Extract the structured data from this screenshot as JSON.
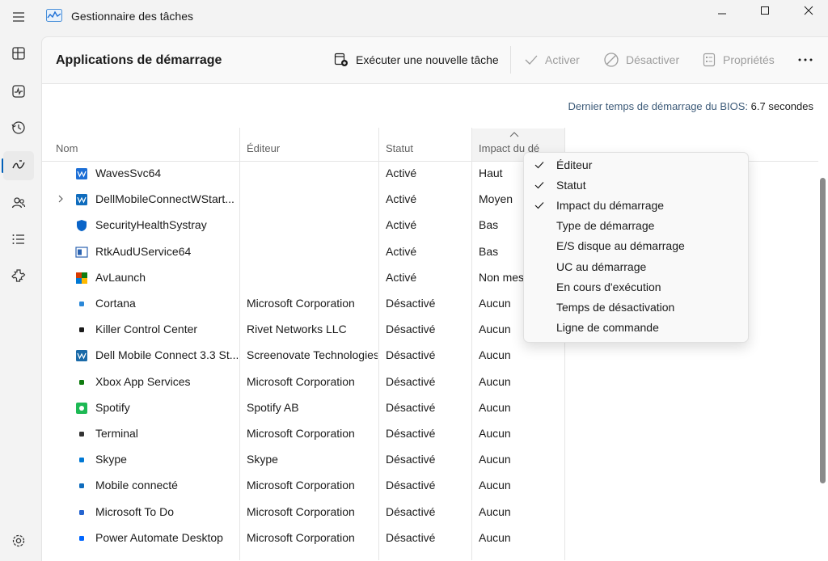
{
  "window": {
    "title": "Gestionnaire des tâches"
  },
  "header": {
    "title": "Applications de démarrage",
    "run_task": "Exécuter une nouvelle tâche",
    "enable": "Activer",
    "disable": "Désactiver",
    "properties": "Propriétés"
  },
  "bios": {
    "label": "Dernier temps de démarrage du BIOS:",
    "value": "6.7 secondes"
  },
  "columns": {
    "name": "Nom",
    "publisher": "Éditeur",
    "status": "Statut",
    "impact": "Impact du dé"
  },
  "rows": [
    {
      "name": "WavesSvc64",
      "publisher": "",
      "status": "Activé",
      "impact": "Haut",
      "icon": "waves-icon",
      "color": "#1d6fd6"
    },
    {
      "name": "DellMobileConnectWStart...",
      "publisher": "",
      "status": "Activé",
      "impact": "Moyen",
      "icon": "dell-mobile-connect-icon",
      "color": "#0f6cbd"
    },
    {
      "name": "SecurityHealthSystray",
      "publisher": "",
      "status": "Activé",
      "impact": "Bas",
      "icon": "shield-icon",
      "color": "#0a64c8"
    },
    {
      "name": "RtkAudUService64",
      "publisher": "",
      "status": "Activé",
      "impact": "Bas",
      "icon": "realtek-icon",
      "color": "#2a62b0"
    },
    {
      "name": "AvLaunch",
      "publisher": "",
      "status": "Activé",
      "impact": "Non mes",
      "icon": "avlaunch-icon",
      "color": "#d83b01"
    },
    {
      "name": "Cortana",
      "publisher": "Microsoft Corporation",
      "status": "Désactivé",
      "impact": "Aucun",
      "icon": "cortana-icon",
      "color": "#2b88d8"
    },
    {
      "name": "Killer Control Center",
      "publisher": "Rivet Networks LLC",
      "status": "Désactivé",
      "impact": "Aucun",
      "icon": "killer-icon",
      "color": "#1b1b1b"
    },
    {
      "name": "Dell Mobile Connect 3.3 St...",
      "publisher": "Screenovate Technologies",
      "status": "Désactivé",
      "impact": "Aucun",
      "icon": "dell-mobile-connect-icon",
      "color": "#1a6aa8"
    },
    {
      "name": "Xbox App Services",
      "publisher": "Microsoft Corporation",
      "status": "Désactivé",
      "impact": "Aucun",
      "icon": "xbox-icon",
      "color": "#107c10"
    },
    {
      "name": "Spotify",
      "publisher": "Spotify AB",
      "status": "Désactivé",
      "impact": "Aucun",
      "icon": "spotify-icon",
      "color": "#1db954"
    },
    {
      "name": "Terminal",
      "publisher": "Microsoft Corporation",
      "status": "Désactivé",
      "impact": "Aucun",
      "icon": "terminal-icon",
      "color": "#333333"
    },
    {
      "name": "Skype",
      "publisher": "Skype",
      "status": "Désactivé",
      "impact": "Aucun",
      "icon": "skype-icon",
      "color": "#0078d4"
    },
    {
      "name": "Mobile connecté",
      "publisher": "Microsoft Corporation",
      "status": "Désactivé",
      "impact": "Aucun",
      "icon": "phone-link-icon",
      "color": "#0f6cbd"
    },
    {
      "name": "Microsoft To Do",
      "publisher": "Microsoft Corporation",
      "status": "Désactivé",
      "impact": "Aucun",
      "icon": "todo-icon",
      "color": "#2564cf"
    },
    {
      "name": "Power Automate Desktop",
      "publisher": "Microsoft Corporation",
      "status": "Désactivé",
      "impact": "Aucun",
      "icon": "power-automate-icon",
      "color": "#0066ff"
    }
  ],
  "context_menu": {
    "items": [
      {
        "label": "Éditeur",
        "checked": true
      },
      {
        "label": "Statut",
        "checked": true
      },
      {
        "label": "Impact du démarrage",
        "checked": true
      },
      {
        "label": "Type de démarrage",
        "checked": false
      },
      {
        "label": "E/S disque au démarrage",
        "checked": false
      },
      {
        "label": "UC au démarrage",
        "checked": false
      },
      {
        "label": "En cours d'exécution",
        "checked": false
      },
      {
        "label": "Temps de désactivation",
        "checked": false
      },
      {
        "label": "Ligne de commande",
        "checked": false
      }
    ]
  },
  "colors": {
    "accent": "#005fb8",
    "bios_label": "#3c5a78"
  }
}
